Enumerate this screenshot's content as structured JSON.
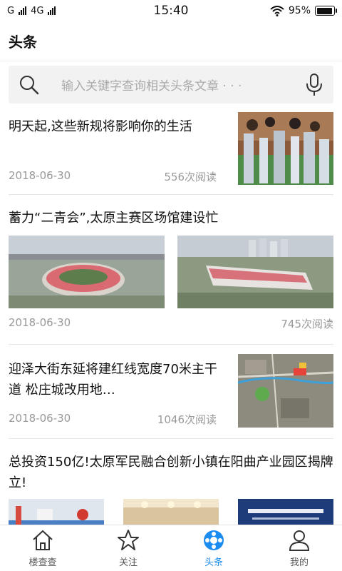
{
  "status_bar": {
    "carrier_1": "G",
    "carrier_2": "4G",
    "time": "15:40",
    "battery_percent": "95%",
    "battery_level": 0.95
  },
  "header": {
    "title": "头条"
  },
  "search": {
    "placeholder": "输入关键字查询相关头条文章 · · ·",
    "search_icon": "search-icon",
    "mic_icon": "microphone-icon"
  },
  "articles": [
    {
      "title": "明天起,这些新规将影响你的生活",
      "date": "2018-06-30",
      "reads": "556次阅读"
    },
    {
      "title": "蓄力“二青会”,太原主赛区场馆建设忙",
      "date": "2018-06-30",
      "reads": "745次阅读"
    },
    {
      "title": "迎泽大街东延将建红线宽度70米主干道 松庄城改用地…",
      "date": "2018-06-30",
      "reads": "1046次阅读"
    },
    {
      "title": "总投资150亿!太原军民融合创新小镇在阳曲产业园区揭牌立!"
    }
  ],
  "tabs": [
    {
      "label": "楼查查",
      "icon": "home-icon",
      "active": false
    },
    {
      "label": "关注",
      "icon": "star-icon",
      "active": false
    },
    {
      "label": "头条",
      "icon": "headlines-icon",
      "active": true
    },
    {
      "label": "我的",
      "icon": "profile-icon",
      "active": false
    }
  ],
  "colors": {
    "accent": "#1c8cf0",
    "meta_text": "#999999",
    "search_bg": "#f2f2f2"
  }
}
